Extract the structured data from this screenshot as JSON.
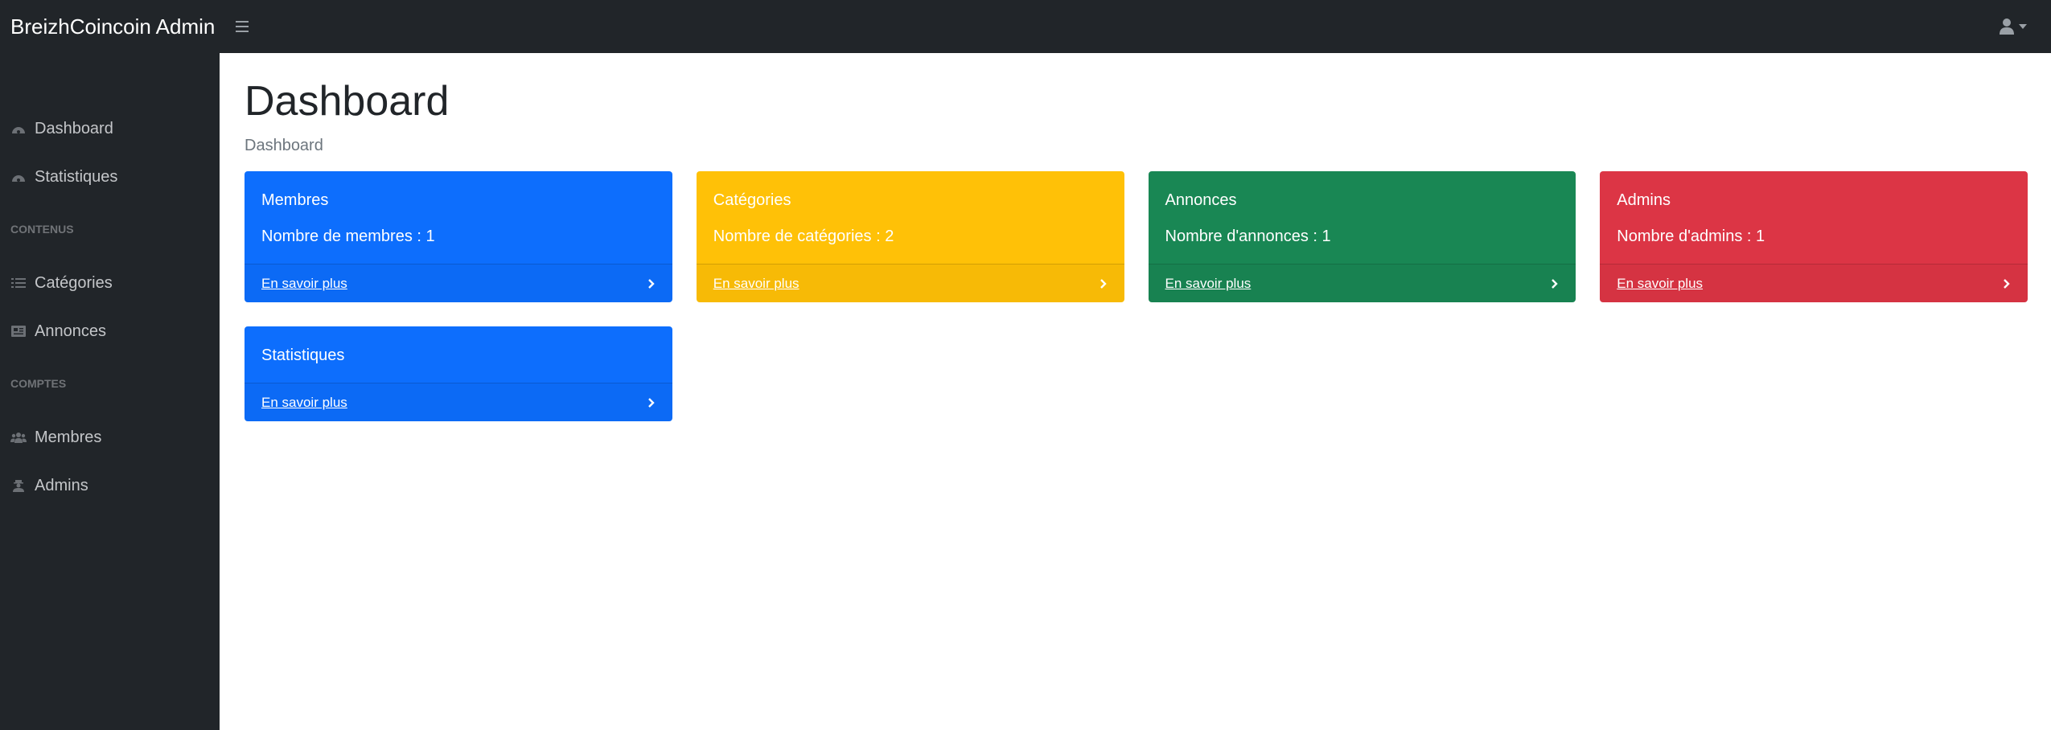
{
  "navbar": {
    "brand": "BreizhCoincoin Admin"
  },
  "sidebar": {
    "items_top": [
      {
        "label": "Dashboard",
        "icon": "dashboard-icon"
      },
      {
        "label": "Statistiques",
        "icon": "dashboard-icon"
      }
    ],
    "heading_content": "CONTENUS",
    "items_content": [
      {
        "label": "Catégories",
        "icon": "list-icon"
      },
      {
        "label": "Annonces",
        "icon": "newspaper-icon"
      }
    ],
    "heading_accounts": "COMPTES",
    "items_accounts": [
      {
        "label": "Membres",
        "icon": "users-icon"
      },
      {
        "label": "Admins",
        "icon": "user-secret-icon"
      }
    ]
  },
  "main": {
    "title": "Dashboard",
    "breadcrumb": "Dashboard",
    "cards": [
      {
        "title": "Membres",
        "body": "Nombre de membres : 1",
        "link": "En savoir plus",
        "color": "#0d6efd"
      },
      {
        "title": "Catégories",
        "body": "Nombre de catégories : 2",
        "link": "En savoir plus",
        "color": "#ffc107"
      },
      {
        "title": "Annonces",
        "body": "Nombre d'annonces : 1",
        "link": "En savoir plus",
        "color": "#198754"
      },
      {
        "title": "Admins",
        "body": "Nombre d'admins : 1",
        "link": "En savoir plus",
        "color": "#dc3545"
      },
      {
        "title": "Statistiques",
        "link": "En savoir plus",
        "color": "#0d6efd"
      }
    ]
  }
}
